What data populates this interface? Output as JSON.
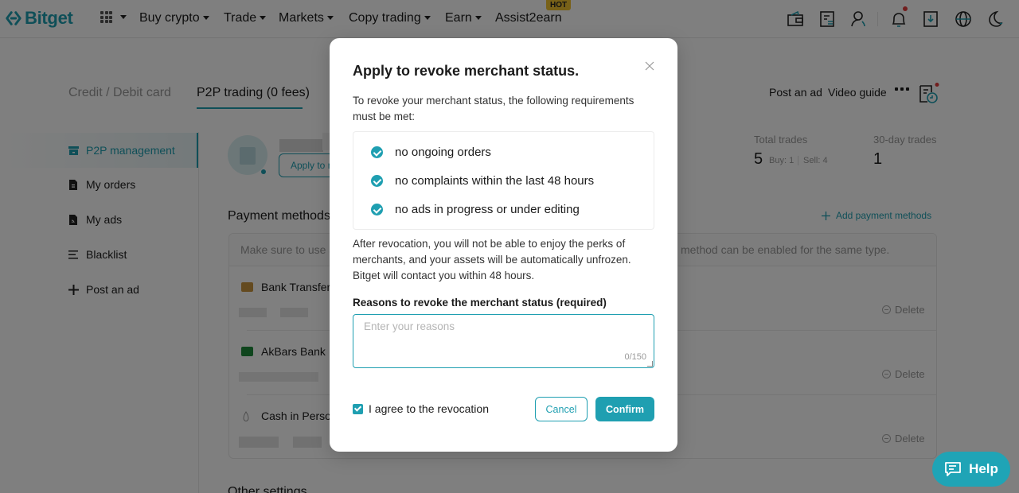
{
  "brand": {
    "name": "Bitget",
    "accent": "#1f9fb1"
  },
  "nav": {
    "items": [
      {
        "label": "Buy crypto",
        "dropdown": true
      },
      {
        "label": "Trade",
        "dropdown": true
      },
      {
        "label": "Markets",
        "dropdown": true
      },
      {
        "label": "Copy trading",
        "dropdown": true
      },
      {
        "label": "Earn",
        "dropdown": true
      },
      {
        "label": "Assist2earn",
        "dropdown": false
      }
    ],
    "hot_badge": "HOT",
    "icons": [
      "wallet-icon",
      "orders-icon",
      "user-icon",
      "bell-icon",
      "download-icon",
      "globe-icon",
      "moon-icon"
    ]
  },
  "tabs": [
    {
      "label": "Credit / Debit card",
      "active": false
    },
    {
      "label": "P2P trading (0 fees)",
      "active": true
    }
  ],
  "toolbar": {
    "post_ad": "Post an ad",
    "video_guide": "Video guide"
  },
  "sidebar": {
    "items": [
      {
        "label": "P2P management",
        "icon": "store-icon",
        "active": true
      },
      {
        "label": "My orders",
        "icon": "document-icon",
        "active": false
      },
      {
        "label": "My ads",
        "icon": "ads-file-icon",
        "active": false
      },
      {
        "label": "Blacklist",
        "icon": "list-icon",
        "active": false
      },
      {
        "label": "Post an ad",
        "icon": "plus-icon",
        "active": false
      }
    ]
  },
  "profile": {
    "apply_button": "Apply to revoke merchant status"
  },
  "stats": {
    "total_trades_label": "Total trades",
    "total_trades": "5",
    "buy": "Buy: 1",
    "sell": "Sell: 4",
    "thirty_day_label": "30-day trades",
    "thirty_day": "1"
  },
  "payment": {
    "title": "Payment methods",
    "add_label": "Add payment methods",
    "note_left": "Make sure to use a",
    "note_right": "method can be enabled for the same type.",
    "methods": [
      {
        "name": "Bank Transfer",
        "delete": "Delete"
      },
      {
        "name": "AkBars Bank",
        "delete": "Delete"
      },
      {
        "name": "Cash in Person",
        "delete": "Delete"
      }
    ]
  },
  "other_settings": "Other settings",
  "help": "Help",
  "modal": {
    "title": "Apply to revoke merchant status.",
    "intro": "To revoke your merchant status, the following requirements must be met:",
    "requirements": [
      "no ongoing orders",
      "no complaints within the last 48 hours",
      "no ads in progress or under editing"
    ],
    "after_text": "After revocation, you will not be able to enjoy the perks of merchants, and your assets will be automatically unfrozen. Bitget will contact you within 48 hours.",
    "reason_label": "Reasons to revoke the merchant status (required)",
    "reason_placeholder": "Enter your reasons",
    "reason_value": "",
    "counter": "0/150",
    "agree_label": "I agree to the revocation",
    "agree_checked": true,
    "cancel": "Cancel",
    "confirm": "Confirm"
  }
}
